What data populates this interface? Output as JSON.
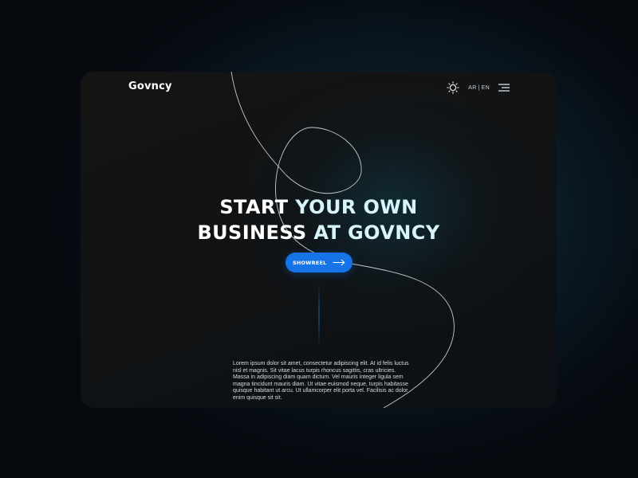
{
  "header": {
    "logo": "Govncy",
    "lang_ar": "AR",
    "lang_sep": "|",
    "lang_en": "EN"
  },
  "hero": {
    "line1_white": "START ",
    "line1_accent": "YOUR OWN",
    "line2_white": "BUSINESS ",
    "line2_accent": "AT GOVNCY",
    "cta_label": "SHOWREEL"
  },
  "body": {
    "paragraph": "Lorem ipsum dolor sit amet, consectetur adipiscing elit. At id felis luctus nisl et magnis. Sit vitae lacus turpis rhoncus sagittis, cras ultricies. Massa in adipiscing diam quam dictum. Vel mauris integer ligula sem magna tincidunt mauris diam. Ut vitae euismod neque, turpis habitasse quisque habitant ut arcu. Ut ullamcorper elit porta vel. Facilisis ac dolor enim quisque sit sit."
  },
  "icons": {
    "theme_toggle": "sun-icon",
    "menu": "hamburger-menu-icon",
    "cta_arrow": "arrow-right-icon"
  },
  "colors": {
    "accent_blue": "#1774e8",
    "headline_accent": "#d7f4fb",
    "card_bg": "#121416",
    "page_bg": "#05080c"
  }
}
